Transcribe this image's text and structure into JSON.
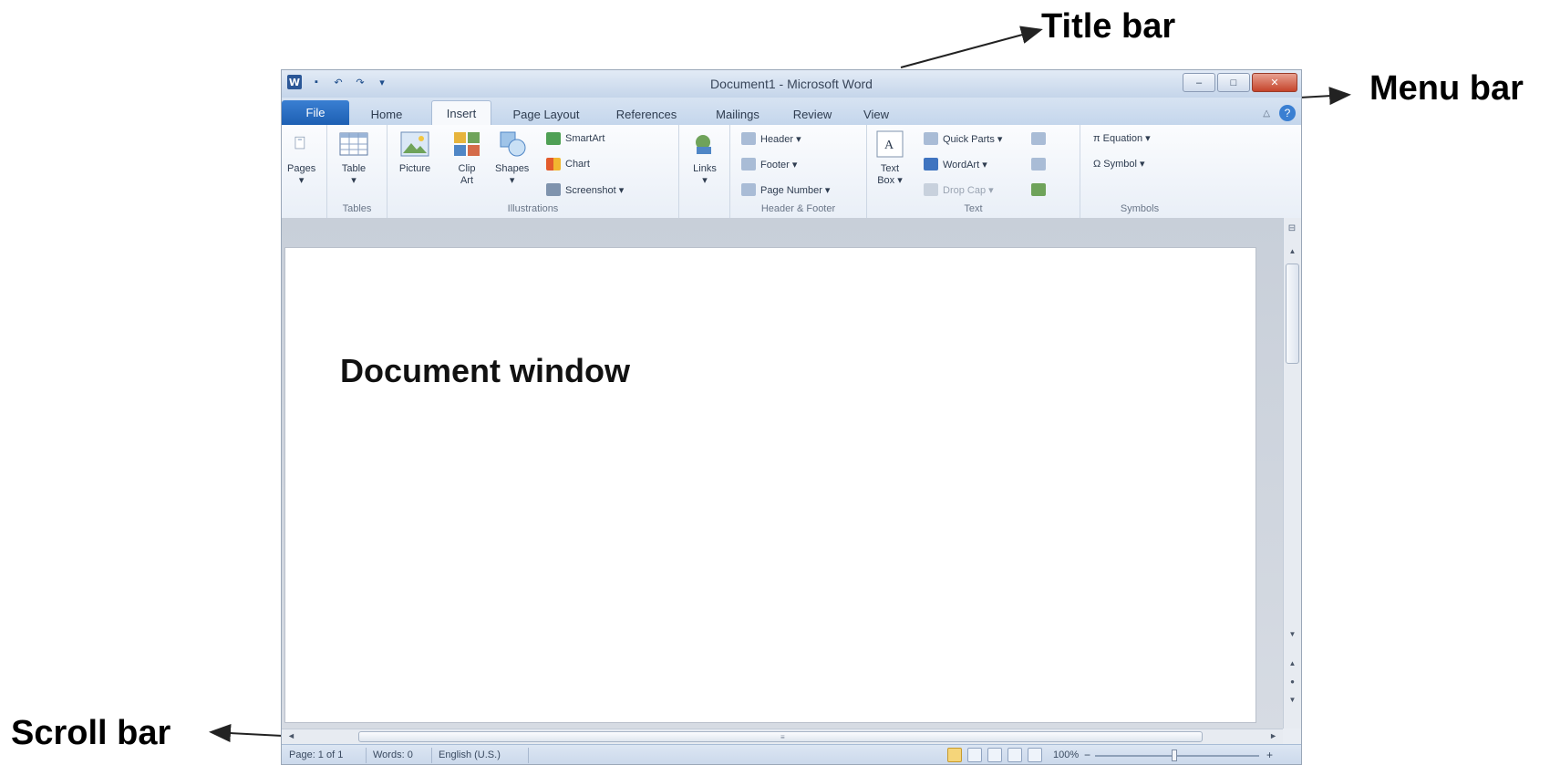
{
  "annotations": {
    "title_bar": "Title bar",
    "menu_bar": "Menu bar",
    "scroll_bar": "Scroll bar",
    "document_window": "Document window"
  },
  "titlebar": {
    "title": "Document1 - Microsoft Word",
    "qat": {
      "word_icon": "W",
      "save_icon": "▪",
      "undo_icon": "↶",
      "redo_icon": "↷",
      "customize_icon": "▾"
    },
    "controls": {
      "minimize": "–",
      "maximize": "□",
      "close": "✕"
    }
  },
  "tabs": {
    "file": "File",
    "home": "Home",
    "insert": "Insert",
    "page_layout": "Page Layout",
    "references": "References",
    "mailings": "Mailings",
    "review": "Review",
    "view": "View",
    "active": "Insert",
    "minimize_icon": "△",
    "help_icon": "?"
  },
  "ribbon": {
    "pages": {
      "label": "Pages",
      "arrow": "▾",
      "group": ""
    },
    "tables": {
      "label": "Table",
      "arrow": "▾",
      "group": "Tables"
    },
    "illustrations": {
      "picture": "Picture",
      "clip_art_line1": "Clip",
      "clip_art_line2": "Art",
      "shapes": "Shapes",
      "shapes_arrow": "▾",
      "smartart": "SmartArt",
      "chart": "Chart",
      "screenshot": "Screenshot ▾",
      "group": "Illustrations"
    },
    "links": {
      "label": "Links",
      "arrow": "▾"
    },
    "header_footer": {
      "header": "Header ▾",
      "footer": "Footer ▾",
      "page_number": "Page Number ▾",
      "group": "Header & Footer"
    },
    "text": {
      "text_box_line1": "Text",
      "text_box_line2": "Box ▾",
      "quick_parts": "Quick Parts ▾",
      "wordart": "WordArt ▾",
      "drop_cap": "Drop Cap ▾",
      "group": "Text"
    },
    "symbols": {
      "equation": "π Equation ▾",
      "symbol": "Ω Symbol ▾",
      "group": "Symbols"
    }
  },
  "statusbar": {
    "page": "Page: 1 of 1",
    "words": "Words: 0",
    "language": "English (U.S.)",
    "zoom": "100%",
    "zoom_minus": "−",
    "zoom_plus": "+"
  },
  "scrollbars": {
    "up": "▲",
    "down": "▼",
    "left": "◄",
    "right": "►",
    "prev_page": "▲",
    "select_browse": "●",
    "next_page": "▼",
    "ruler": "⊟",
    "grip": "≡"
  },
  "colors": {
    "file_tab": "#1d5fb3",
    "ribbon_bg": "#e9eff7",
    "document_bg": "#ffffff",
    "close_button": "#c5442b"
  }
}
